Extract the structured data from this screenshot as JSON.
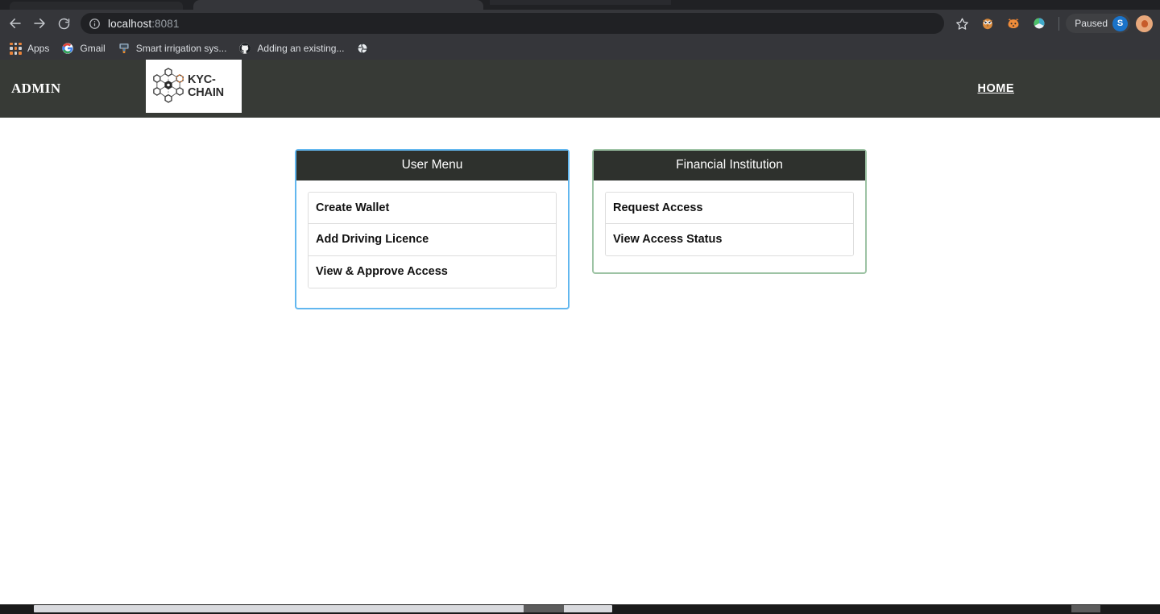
{
  "browser": {
    "back_label": "Back",
    "forward_label": "Forward",
    "reload_label": "Reload",
    "url_host": "localhost",
    "url_port": ":8081",
    "url_full": "localhost:8081",
    "bookmark_star_label": "Bookmark this tab",
    "profile_status": "Paused",
    "profile_initial": "S",
    "bookmarks": [
      {
        "label": "Apps",
        "icon": "apps-grid-icon"
      },
      {
        "label": "Gmail",
        "icon": "gmail-icon"
      },
      {
        "label": "Smart irrigation sys...",
        "icon": "favicon-irrigation-icon"
      },
      {
        "label": "Adding an existing...",
        "icon": "github-icon"
      },
      {
        "label": "",
        "icon": "globe-icon"
      }
    ],
    "extensions": [
      {
        "name": "extension-owl-icon"
      },
      {
        "name": "extension-fox-icon"
      },
      {
        "name": "extension-metamask-icon"
      }
    ]
  },
  "navbar": {
    "brand": "ADMIN",
    "logo_text": "KYC-CHAIN",
    "logo_alt": "kyc-chain-logo",
    "home_link": "HOME",
    "background_color": "#373a36"
  },
  "cards": [
    {
      "id": "user-menu",
      "title": "User Menu",
      "border_color": "#62b7ef",
      "header_color": "#2e312d",
      "items": [
        "Create Wallet",
        "Add Driving Licence",
        "View & Approve Access"
      ]
    },
    {
      "id": "financial-institution",
      "title": "Financial Institution",
      "border_color": "#9dc3a4",
      "header_color": "#2e312d",
      "items": [
        "Request Access",
        "View Access Status"
      ]
    }
  ]
}
